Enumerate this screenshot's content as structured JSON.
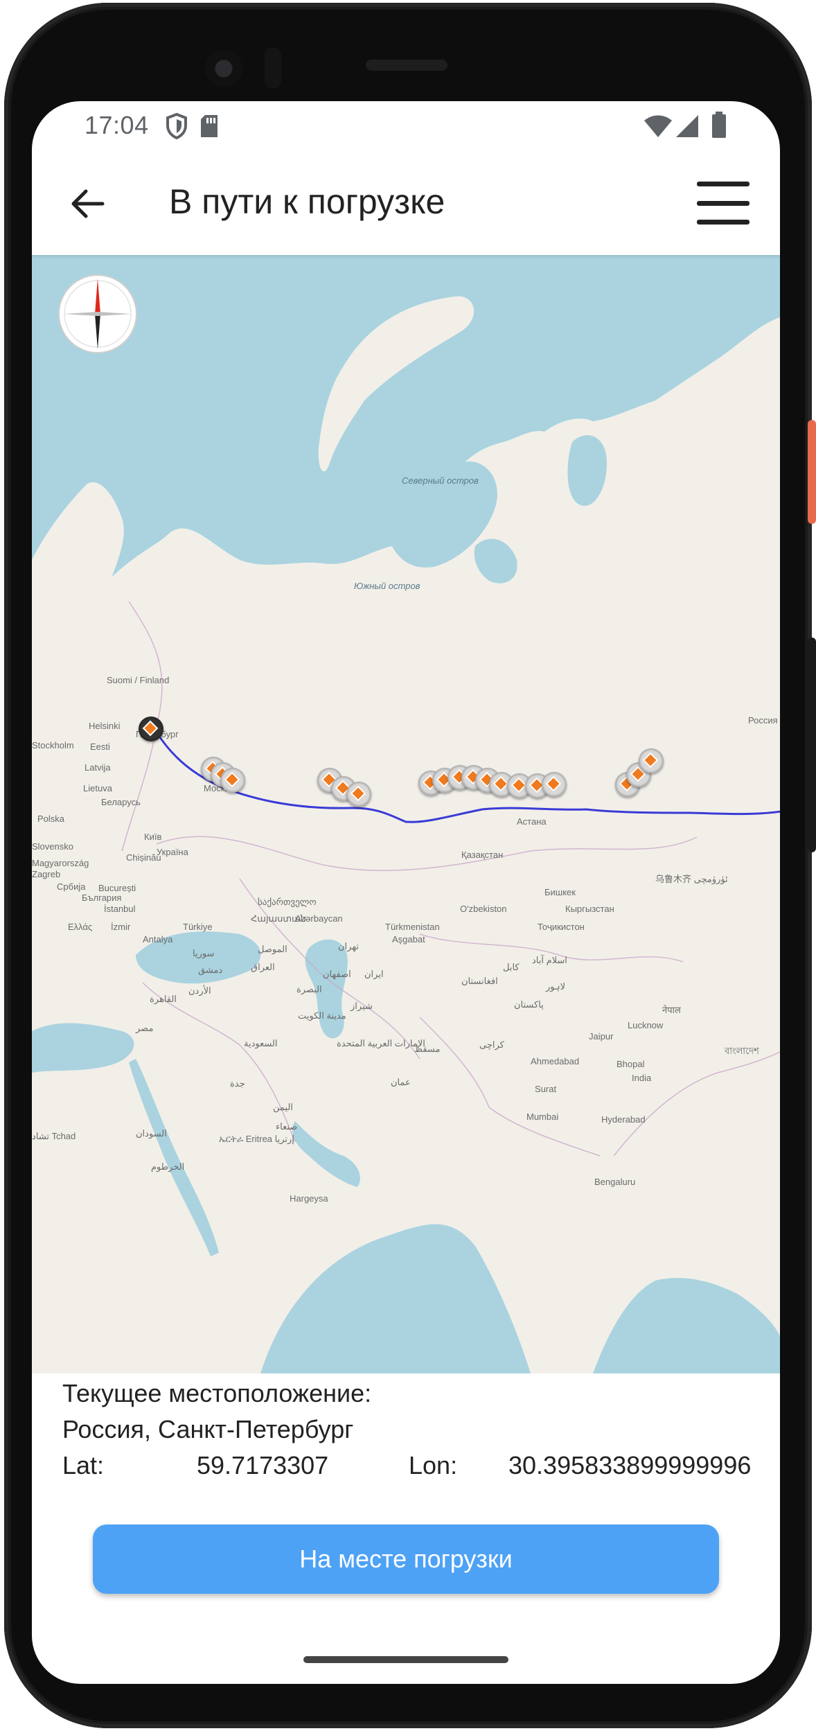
{
  "status_bar": {
    "time": "17:04",
    "icons": [
      "shield-icon",
      "sd-card-icon",
      "wifi-icon",
      "signal-icon",
      "battery-icon"
    ]
  },
  "app_bar": {
    "title": "В пути к погрузке",
    "back_icon": "arrow-back-icon",
    "menu_icon": "hamburger-menu-icon"
  },
  "map": {
    "place_labels": {
      "severny": "Северный остров",
      "yuzhny": "Южный остров",
      "suomi": "Suomi / Finland",
      "helsinki": "Helsinki",
      "stockholm": "Stockholm",
      "eesti": "Eesti",
      "latvija": "Latvija",
      "lietuva": "Lietuva",
      "belarus": "Беларусь",
      "polska": "Polska",
      "kyiv": "Київ",
      "ukraina": "Україна",
      "slovensko": "Slovensko",
      "magyarorszag": "Magyarország",
      "chisinau": "Chișinău",
      "zagreb": "Zagreb",
      "srbija": "Србија",
      "bucuresti": "București",
      "bulgaria": "България",
      "istanbul": "İstanbul",
      "ellas": "Ελλάς",
      "izmir": "İzmir",
      "turkiye": "Türkiye",
      "antalya": "Antalya",
      "moskva": "Москва",
      "rossiya": "Россия",
      "astana": "Астана",
      "kazakstan": "Қазақстан",
      "georgia": "საქართველო",
      "armenia": "Հայաստան",
      "azerbaycan": "Azərbaycan",
      "turkmenistan": "Türkmenistan",
      "ashgabat": "Aşgabat",
      "uzbekiston": "O'zbekiston",
      "bishkek": "Бишкек",
      "kyrgyzstan": "Кыргызстан",
      "tojikiston": "Тоҷикистон",
      "urumqi": "乌鲁木齐 ئۈرۈمچی",
      "tehran": "تهران",
      "iraq": "العراق",
      "syria": "سوريا",
      "dimashq": "دمشق",
      "mosul": "الموصل",
      "isfahan": "اصفهان",
      "shiraz": "شیراز",
      "iran": "ایران",
      "kuwait": "مدينة الكويت",
      "basra": "البصرة",
      "urdun": "الأردن",
      "qahira": "القاهرة",
      "misr": "مصر",
      "saudi": "السعودية",
      "uae": "الإمارات العربية المتحدة",
      "muscat": "مسقط",
      "oman": "عمان",
      "jeddah": "جدة",
      "sanaa": "صنعاء",
      "yemen": "اليمن",
      "sudan": "السودان",
      "khartoum": "الخرطوم",
      "eritrea": "ኤርትራ Eritrea إرتريا",
      "chad": "تشاد Tchad",
      "hargeysa": "Hargeysa",
      "afghanistan": "افغانستان",
      "kabul": "کابل",
      "islamabad": "اسلام آباد",
      "pakistan": "پاکستان",
      "lahore": "لاہور",
      "karachi": "کراچی",
      "jaipur": "Jaipur",
      "lucknow": "Lucknow",
      "ahmedabad": "Ahmedabad",
      "bhopal": "Bhopal",
      "india": "India",
      "surat": "Surat",
      "mumbai": "Mumbai",
      "hyderabad": "Hyderabad",
      "bengaluru": "Bengaluru",
      "nepal": "नेपाल",
      "bangladesh": "বাংলাদেশ",
      "peterburg": "Петербург"
    },
    "route_color": "#3a3ad6",
    "marker_color": "#f07a1e"
  },
  "location": {
    "heading": "Текущее местоположение:",
    "place": "Россия, Санкт-Петербург",
    "lat_label": "Lat:",
    "lat_value": "59.7173307",
    "lon_label": "Lon:",
    "lon_value": "30.395833899999996"
  },
  "action": {
    "button_label": "На месте погрузки",
    "color": "#4da2f5"
  }
}
